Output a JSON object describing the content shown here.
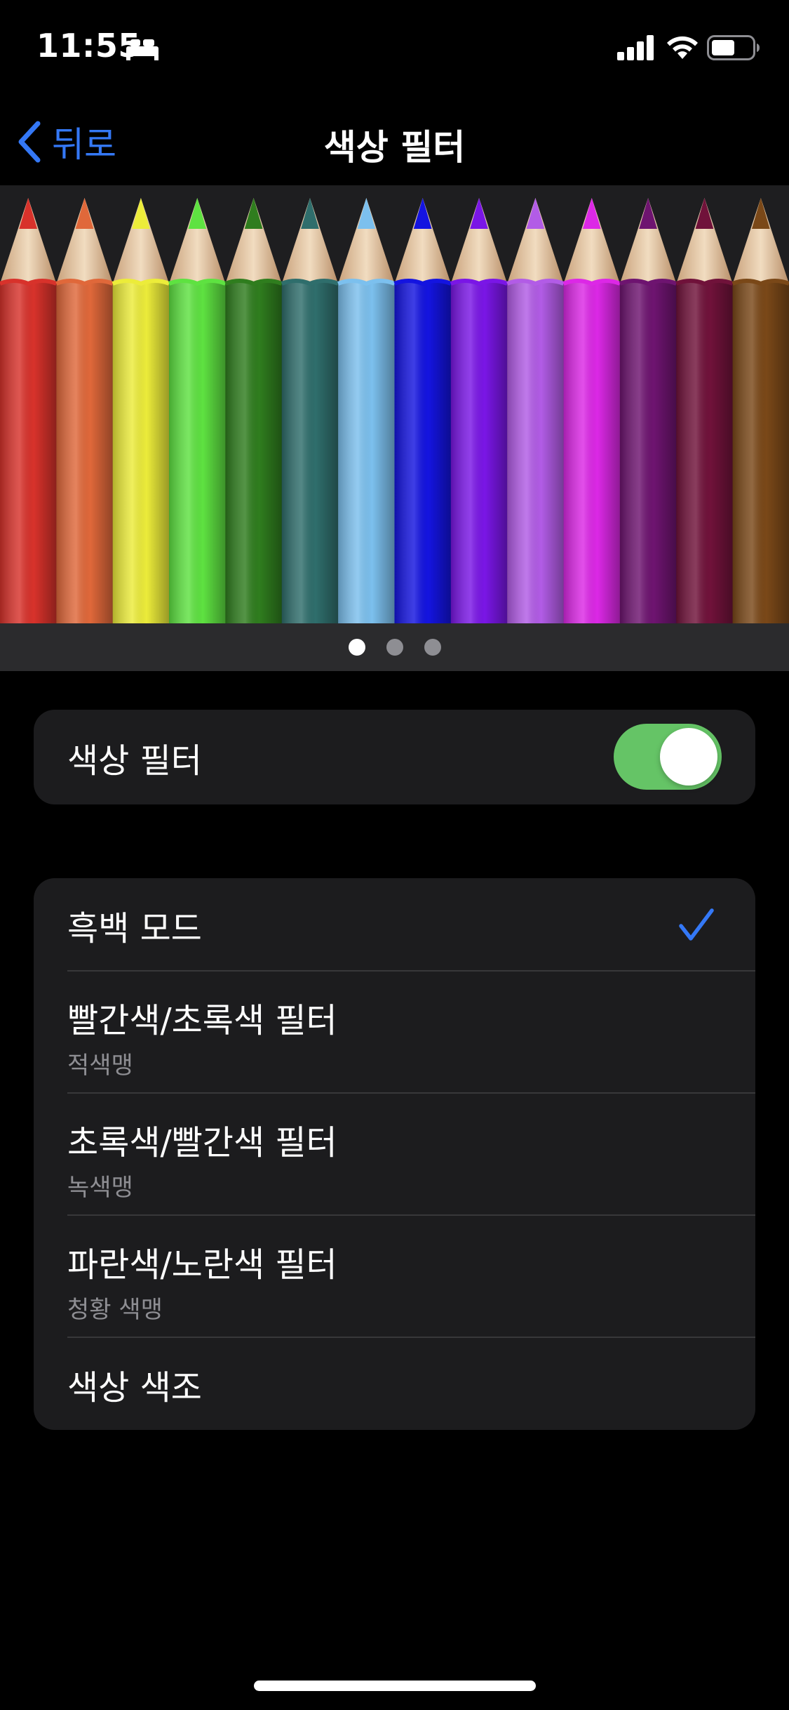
{
  "status_bar": {
    "time": "11:55",
    "focus_icon": "bed-icon",
    "signal_icon": "cellular-signal-icon",
    "wifi_icon": "wifi-icon",
    "battery_icon": "battery-icon"
  },
  "nav": {
    "back_label": "뒤로",
    "title": "색상 필터"
  },
  "preview": {
    "pencil_colors": [
      "#d8322b",
      "#e0683a",
      "#ecec3a",
      "#5ee241",
      "#2f7d1e",
      "#2f6e6c",
      "#7cc0ee",
      "#1414e0",
      "#7a16e6",
      "#b25ce6",
      "#dc28e6",
      "#6e1470",
      "#70123a",
      "#7a4818"
    ],
    "page_count": 3,
    "active_page": 1
  },
  "toggle_section": {
    "label": "색상 필터",
    "enabled": true
  },
  "options": [
    {
      "label": "흑백 모드",
      "sub": "",
      "selected": true
    },
    {
      "label": "빨간색/초록색 필터",
      "sub": "적색맹",
      "selected": false
    },
    {
      "label": "초록색/빨간색 필터",
      "sub": "녹색맹",
      "selected": false
    },
    {
      "label": "파란색/노란색 필터",
      "sub": "청황 색맹",
      "selected": false
    },
    {
      "label": "색상 색조",
      "sub": "",
      "selected": false
    }
  ],
  "colors": {
    "accent": "#3478f6",
    "toggle_on": "#65c466",
    "group_bg": "#1c1c1e",
    "preview_bg": "#2b2b2d"
  }
}
